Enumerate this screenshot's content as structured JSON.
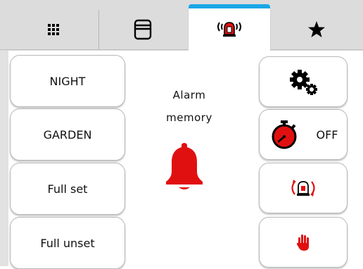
{
  "tabs": [
    {
      "name": "grid-icon",
      "active": false
    },
    {
      "name": "window-icon",
      "active": false
    },
    {
      "name": "alarm-light-icon",
      "active": true
    },
    {
      "name": "star-icon",
      "active": false
    }
  ],
  "left_buttons": {
    "night": "NIGHT",
    "garden": "GARDEN",
    "full_set": "Full set",
    "full_unset": "Full unset"
  },
  "center": {
    "title_line1": "Alarm",
    "title_line2": "memory",
    "icon": "bell-icon"
  },
  "right_buttons": {
    "settings_icon": "gears-icon",
    "timer_icon": "stopwatch-icon",
    "timer_state": "OFF",
    "siren_icon": "siren-cycle-icon",
    "stop_icon": "hand-icon"
  },
  "colors": {
    "accent": "#1aa6e6",
    "alarm_red": "#e01010",
    "tab_bar": "#dcdcdc"
  }
}
